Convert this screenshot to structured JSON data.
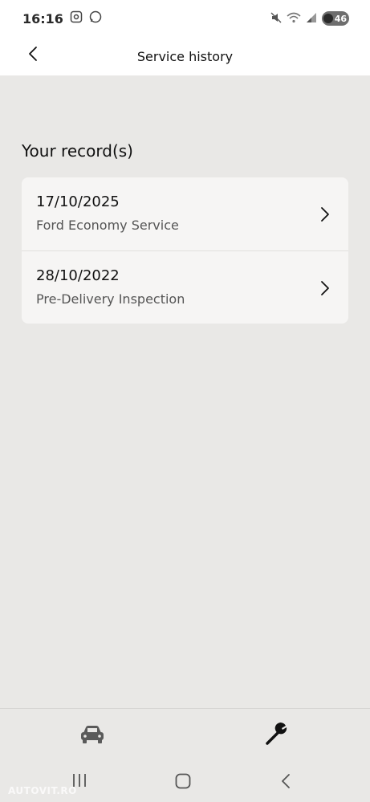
{
  "status_bar": {
    "time": "16:16",
    "battery": "46",
    "icons": [
      "screenshot-icon",
      "whatsapp-icon",
      "mute-icon",
      "wifi-icon",
      "signal-icon"
    ]
  },
  "header": {
    "title": "Service history",
    "back_icon": "chevron-left-icon"
  },
  "records": {
    "title": "Your record(s)",
    "items": [
      {
        "date": "17/10/2025",
        "service": "Ford Economy Service"
      },
      {
        "date": "28/10/2022",
        "service": "Pre-Delivery Inspection"
      }
    ]
  },
  "bottom_nav": {
    "items": [
      {
        "icon": "car-icon",
        "active": false
      },
      {
        "icon": "wrench-icon",
        "active": true
      }
    ]
  },
  "watermark": "AUTOVIT.RO",
  "colors": {
    "background": "#e9e8e6",
    "card": "#f6f5f4",
    "header": "#ffffff",
    "text_primary": "#111111",
    "text_secondary": "#555555"
  }
}
